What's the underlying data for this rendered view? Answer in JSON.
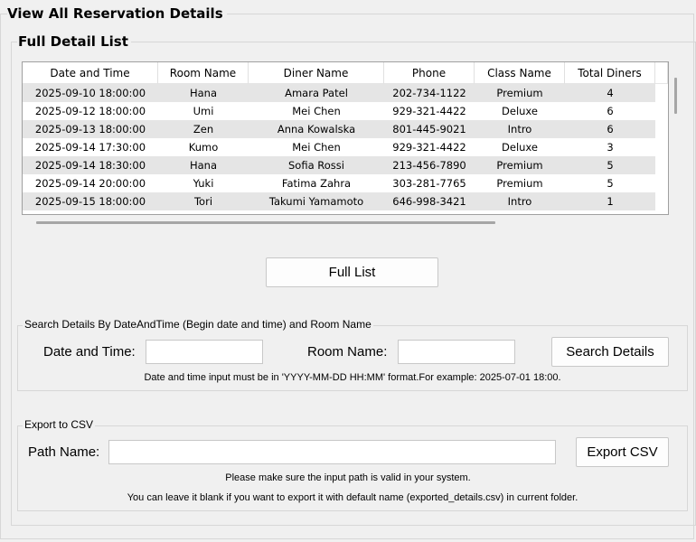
{
  "page": {
    "title": "View All Reservation Details"
  },
  "list": {
    "title": "Full Detail List",
    "columns": [
      "Date and Time",
      "Room Name",
      "Diner Name",
      "Phone",
      "Class Name",
      "Total Diners"
    ],
    "rows": [
      [
        "2025-09-10 18:00:00",
        "Hana",
        "Amara Patel",
        "202-734-1122",
        "Premium",
        "4"
      ],
      [
        "2025-09-12 18:00:00",
        "Umi",
        "Mei Chen",
        "929-321-4422",
        "Deluxe",
        "6"
      ],
      [
        "2025-09-13 18:00:00",
        "Zen",
        "Anna Kowalska",
        "801-445-9021",
        "Intro",
        "6"
      ],
      [
        "2025-09-14 17:30:00",
        "Kumo",
        "Mei Chen",
        "929-321-4422",
        "Deluxe",
        "3"
      ],
      [
        "2025-09-14 18:30:00",
        "Hana",
        "Sofia Rossi",
        "213-456-7890",
        "Premium",
        "5"
      ],
      [
        "2025-09-14 20:00:00",
        "Yuki",
        "Fatima Zahra",
        "303-281-7765",
        "Premium",
        "5"
      ],
      [
        "2025-09-15 18:00:00",
        "Tori",
        "Takumi Yamamoto",
        "646-998-3421",
        "Intro",
        "1"
      ]
    ],
    "full_list_button": "Full List"
  },
  "search": {
    "group_label": "Search Details By DateAndTime (Begin date and time) and Room Name",
    "date_label": "Date and Time:",
    "date_value": "",
    "room_label": "Room Name:",
    "room_value": "",
    "button": "Search Details",
    "hint": "Date and time input must be in 'YYYY-MM-DD HH:MM' format.For example: 2025-07-01 18:00."
  },
  "export": {
    "group_label": "Export to CSV",
    "path_label": "Path Name:",
    "path_value": "",
    "button": "Export CSV",
    "hint1": "Please make sure the input path is valid in your system.",
    "hint2": "You can leave it blank if you want to export it with default name (exported_details.csv) in current folder."
  }
}
